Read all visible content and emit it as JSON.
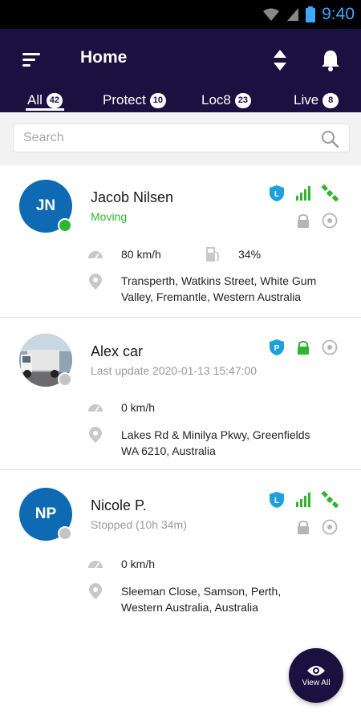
{
  "status_bar": {
    "time": "9:40"
  },
  "header": {
    "title": "Home",
    "menu_icon": "menu-icon",
    "sort_icon": "sort-icon",
    "bell_icon": "bell-icon"
  },
  "tabs": [
    {
      "label": "All",
      "count": "42",
      "active": true
    },
    {
      "label": "Protect",
      "count": "10"
    },
    {
      "label": "Loc8",
      "count": "23"
    },
    {
      "label": "Live",
      "count": "8"
    }
  ],
  "search": {
    "placeholder": "Search"
  },
  "units": [
    {
      "initials": "JN",
      "name": "Jacob Nilsen",
      "status": "Moving",
      "status_color": "#2fb52f",
      "speed": "80 km/h",
      "fuel": "34%",
      "address_line1": "Transperth, Watkins Street, White Gum",
      "address_line2": "Valley, Fremantle, Western Australia",
      "badges": [
        "loc8-shield-icon",
        "signal-icon",
        "gps-satellite-icon",
        "lock-icon",
        "target-icon"
      ]
    },
    {
      "initials": "",
      "name": "Alex car",
      "status": "Last update 2020-01-13 15:47:00",
      "status_color": "#bdbdbd",
      "speed": "0 km/h",
      "address_line1": "Lakes Rd & Minilya Pkwy, Greenfields",
      "address_line2": "WA 6210, Australia",
      "badges": [
        "protect-shield-icon",
        "lock-icon",
        "target-icon"
      ]
    },
    {
      "initials": "NP",
      "name": "Nicole P.",
      "status": "Stopped (10h 34m)",
      "status_color": "#bdbdbd",
      "speed": "0 km/h",
      "address_line1": "Sleeman Close, Samson, Perth,",
      "address_line2": "Western Australia, Australia",
      "badges": [
        "loc8-shield-icon",
        "signal-icon",
        "gps-satellite-icon",
        "lock-icon",
        "target-icon"
      ]
    }
  ],
  "fab": {
    "label": "View All",
    "icon": "eye-icon"
  },
  "colors": {
    "header_bg": "#1a1140",
    "avatar_bg": "#0f6ab4",
    "accent_blue": "#1ea0dc",
    "accent_green": "#2fb52f",
    "icon_gray": "#b5b5b5"
  }
}
